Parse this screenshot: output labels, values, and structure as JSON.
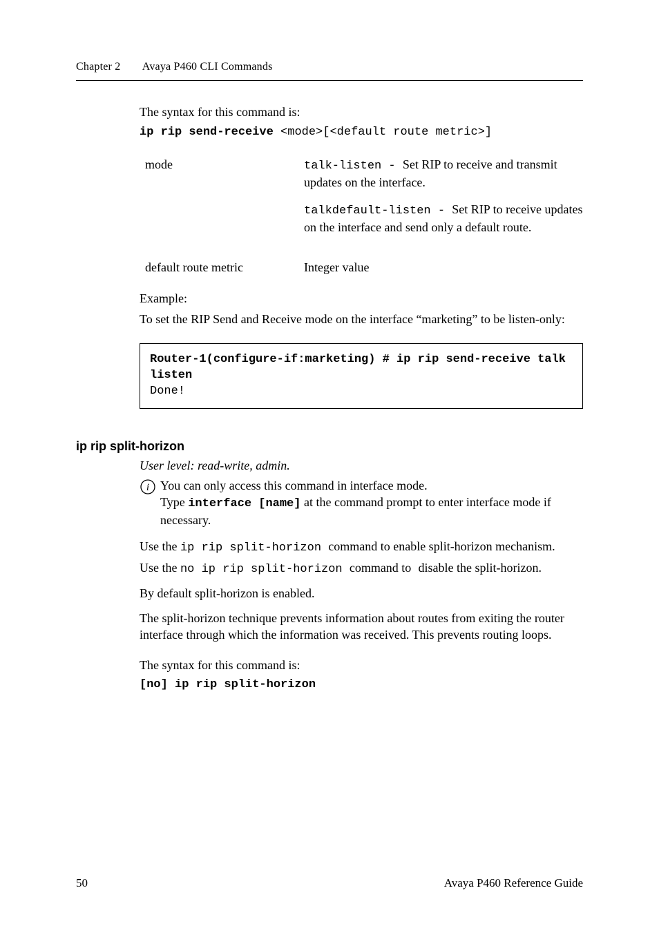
{
  "header": {
    "chapter": "Chapter 2",
    "title": "Avaya P460 CLI Commands"
  },
  "syntax_intro": "The syntax for this command is:",
  "cmd1": {
    "prefix_bold": "ip rip send-receive ",
    "args": "<mode>[<default route metric>]"
  },
  "defs": {
    "mode_term": "mode",
    "mode_b1_code": "talk-listen - ",
    "mode_b1_rest": "Set RIP to receive and transmit updates on the interface.",
    "mode_b2_code": "talkdefault-listen - ",
    "mode_b2_rest": "Set RIP to receive updates on the interface and send only a default route.",
    "metric_term": "default route metric",
    "metric_body": "Integer value"
  },
  "example_label": "Example:",
  "example_desc": "To set the RIP Send and Receive mode on the interface “marketing” to be listen-only:",
  "codebox1": {
    "line1_bold": "Router-1(configure-if:marketing) # ip rip send-receive talk listen",
    "line2": "Done!"
  },
  "section2": {
    "heading": "ip rip split-horizon",
    "userlevel": "User level: read-write, admin.",
    "note1": "You can only access this command in interface mode.",
    "note2_pre": "Type ",
    "note2_code": "interface [name]",
    "note2_post": " at the command prompt to enter interface mode if necessary.",
    "p1_pre": "Use the ",
    "p1_code": "ip rip split-horizon ",
    "p1_post": "command to enable split-horizon mechanism.",
    "p2_pre": "Use the ",
    "p2_code": "no ip rip split-horizon ",
    "p2_mid": "command to",
    "p2_post": "disable the split-horizon.",
    "p3": "By default split-horizon is enabled.",
    "p4": "The split-horizon technique prevents information about routes from exiting the router interface through which the information was received. This prevents routing loops.",
    "syntax_intro2": "The syntax for this command is:",
    "cmd2": "[no] ip rip split-horizon"
  },
  "footer": {
    "page": "50",
    "doc": "Avaya P460 Reference Guide"
  }
}
